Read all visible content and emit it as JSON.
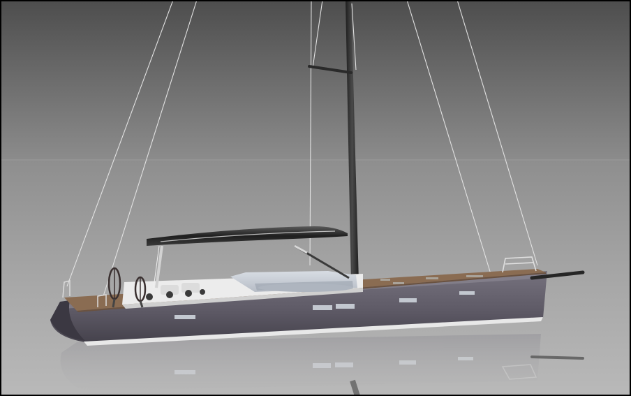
{
  "image": {
    "subject": "sailing-yacht-render",
    "colors": {
      "frame": "#000000",
      "sky_top": "#505050",
      "sky_horizon": "#8a8a8a",
      "floor": "#a9a9a9",
      "hull": "#5f5b66",
      "hull_highlight": "#7a7682",
      "deck_teak": "#8a6e54",
      "deck_white": "#ececec",
      "mast": "#2e2e2e",
      "boom": "#2a2a2a",
      "portlight": "#bfc4cc",
      "rigging": "#e6e6e6"
    }
  }
}
